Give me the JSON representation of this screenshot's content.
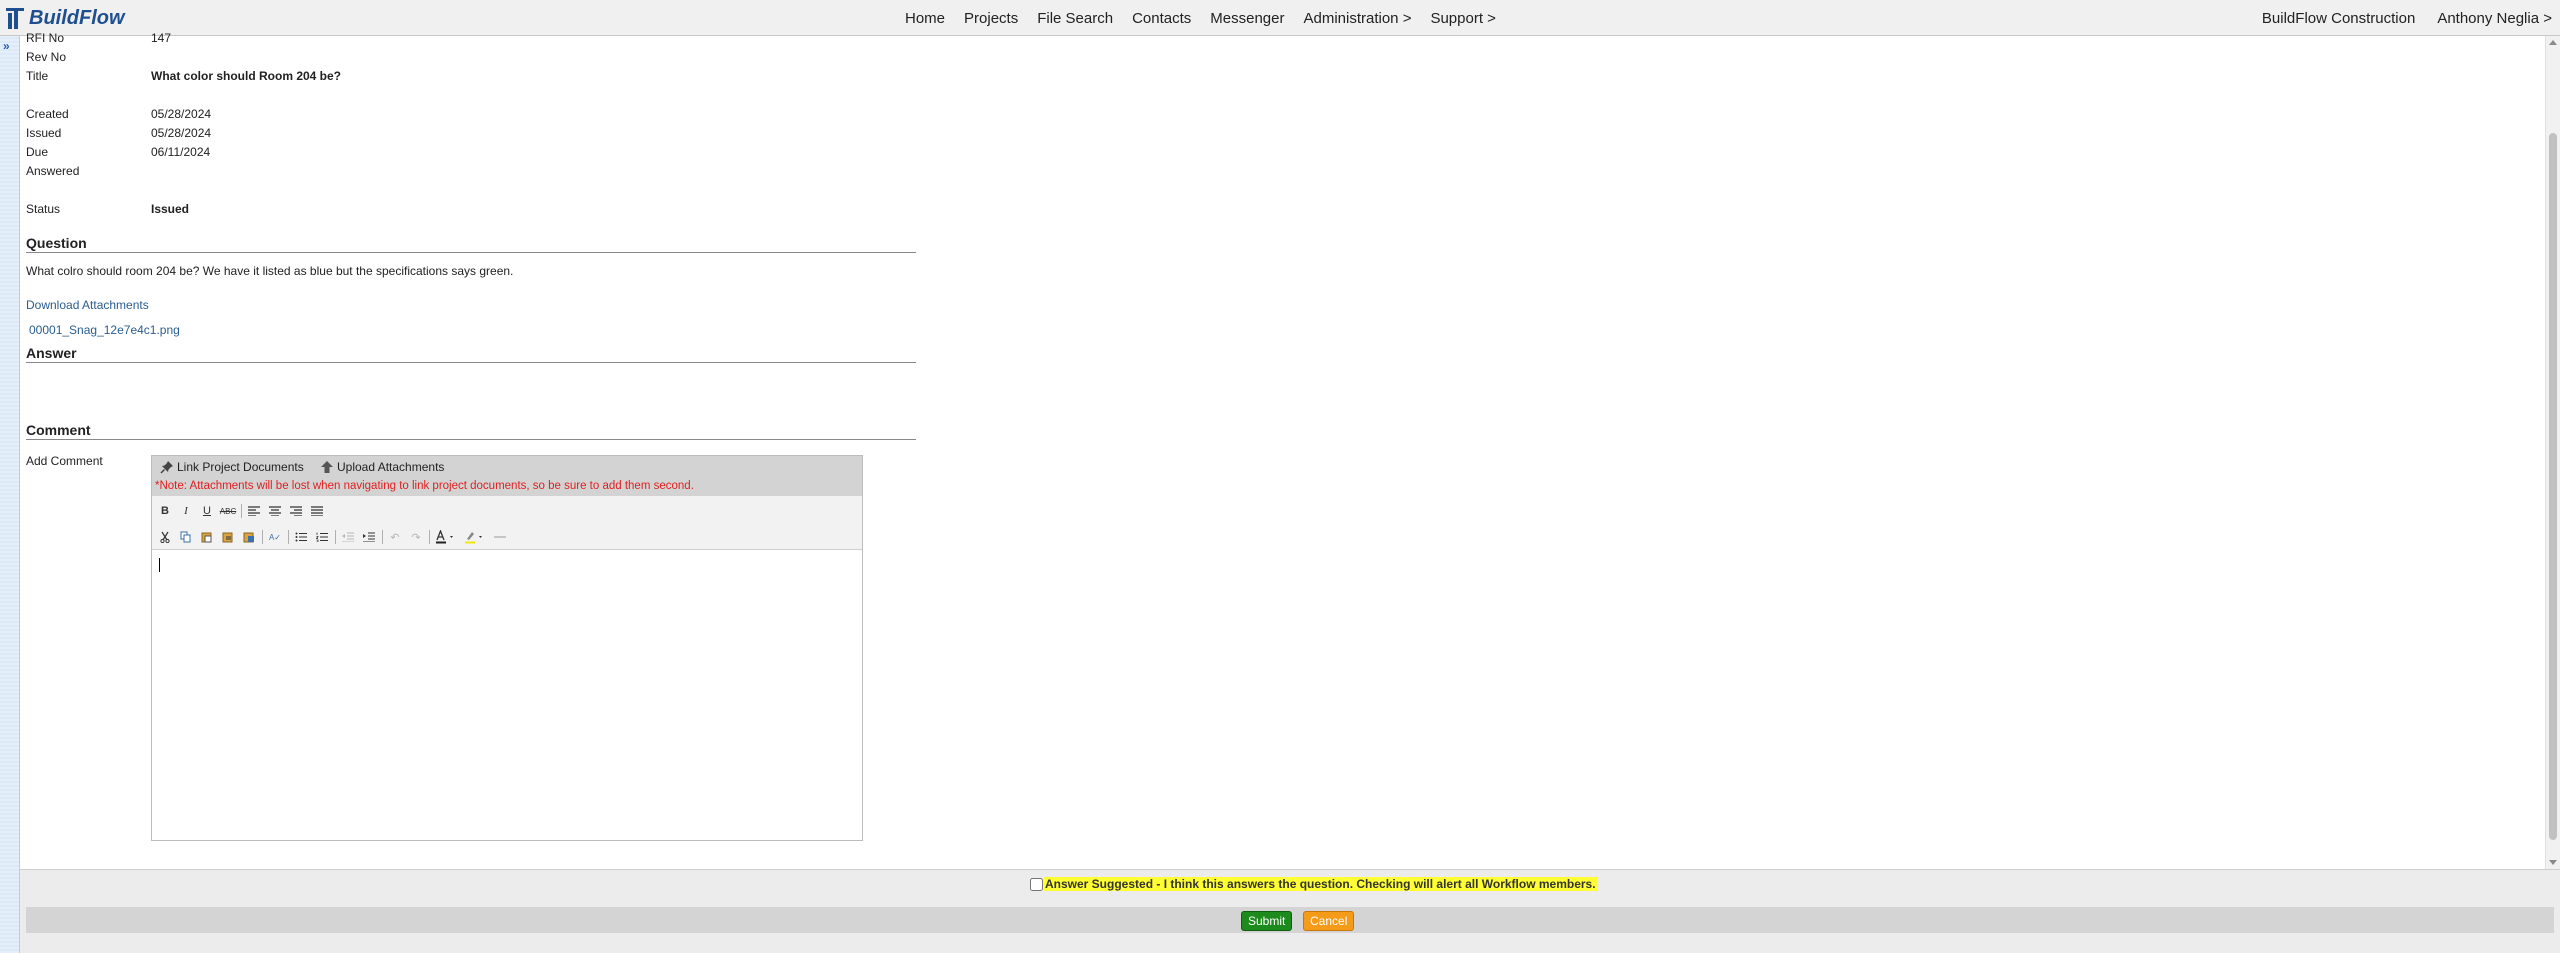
{
  "app": {
    "logo_text": "BuildFlow"
  },
  "nav": {
    "items": [
      "Home",
      "Projects",
      "File Search",
      "Contacts",
      "Messenger",
      "Administration >",
      "Support >"
    ],
    "company": "BuildFlow Construction",
    "user": "Anthony Neglia >"
  },
  "rail": {
    "toggle": "»"
  },
  "rfi": {
    "fields": [
      {
        "label": "RFI No",
        "value": "147"
      },
      {
        "label": "Rev No",
        "value": ""
      },
      {
        "label": "Title",
        "value": "What color should Room 204 be?"
      },
      {
        "label": "Created",
        "value": "05/28/2024"
      },
      {
        "label": "Issued",
        "value": "05/28/2024"
      },
      {
        "label": "Due",
        "value": "06/11/2024"
      },
      {
        "label": "Answered",
        "value": ""
      },
      {
        "label": "Status",
        "value": "Issued"
      }
    ]
  },
  "question": {
    "header": "Question",
    "text": "What colro should room 204 be? We have it listed as blue but the specifications says green.",
    "download_link": "Download Attachments",
    "attachment": "00001_Snag_12e7e4c1.png"
  },
  "answer": {
    "header": "Answer"
  },
  "comment": {
    "header": "Comment",
    "add_label": "Add Comment",
    "link_docs": "Link Project Documents",
    "upload": "Upload Attachments",
    "note": "*Note: Attachments will be lost when navigating to link project documents, so be sure to add them second."
  },
  "footer": {
    "suggest_label": "Answer Suggested - I think this answers the question. Checking will alert all Workflow members.",
    "suggest_checked": false,
    "submit": "Submit",
    "cancel": "Cancel"
  },
  "colors": {
    "brand": "#1f4f8f",
    "note_red": "#e02020",
    "submit_green": "#1d8a1d",
    "cancel_orange": "#f59b1a",
    "highlight_yellow": "#ffff33"
  }
}
